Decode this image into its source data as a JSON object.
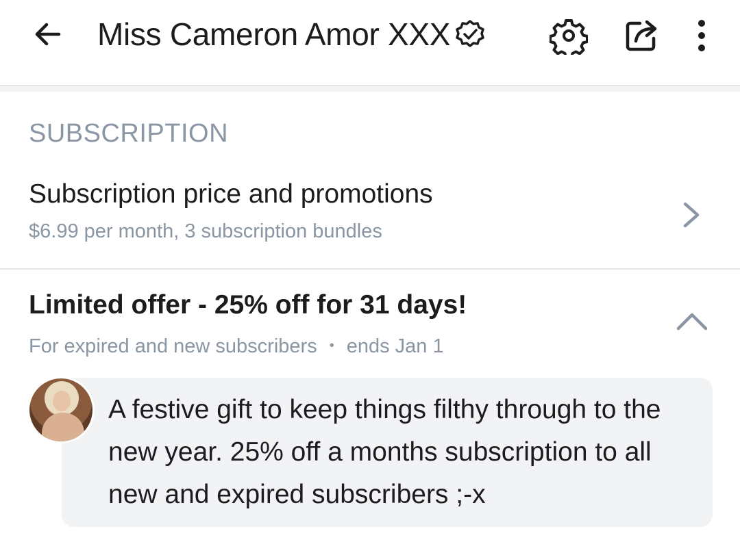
{
  "header": {
    "title": "Miss Cameron Amor XXX"
  },
  "subscription_section": {
    "title": "SUBSCRIPTION",
    "price_row": {
      "title": "Subscription price and promotions",
      "subtitle": "$6.99 per month, 3 subscription bundles"
    }
  },
  "offer": {
    "title": "Limited offer - 25% off for 31 days!",
    "audience": "For expired and new subscribers",
    "separator": "•",
    "ends": "ends Jan 1",
    "message": "A festive gift to keep things filthy through to the new year. 25% off a months subscription to all new and expired subscribers ;-x"
  },
  "icons": {
    "back": "back-arrow-icon",
    "verified": "verified-badge-icon",
    "settings": "gear-icon",
    "share": "share-icon",
    "more": "more-vertical-icon",
    "chevron_right": "chevron-right-icon",
    "chevron_up": "chevron-up-icon"
  },
  "colors": {
    "text": "#1c1c1e",
    "muted": "#8a96a3",
    "bubble": "#f2f3f5",
    "divider": "#e4e6e9"
  }
}
